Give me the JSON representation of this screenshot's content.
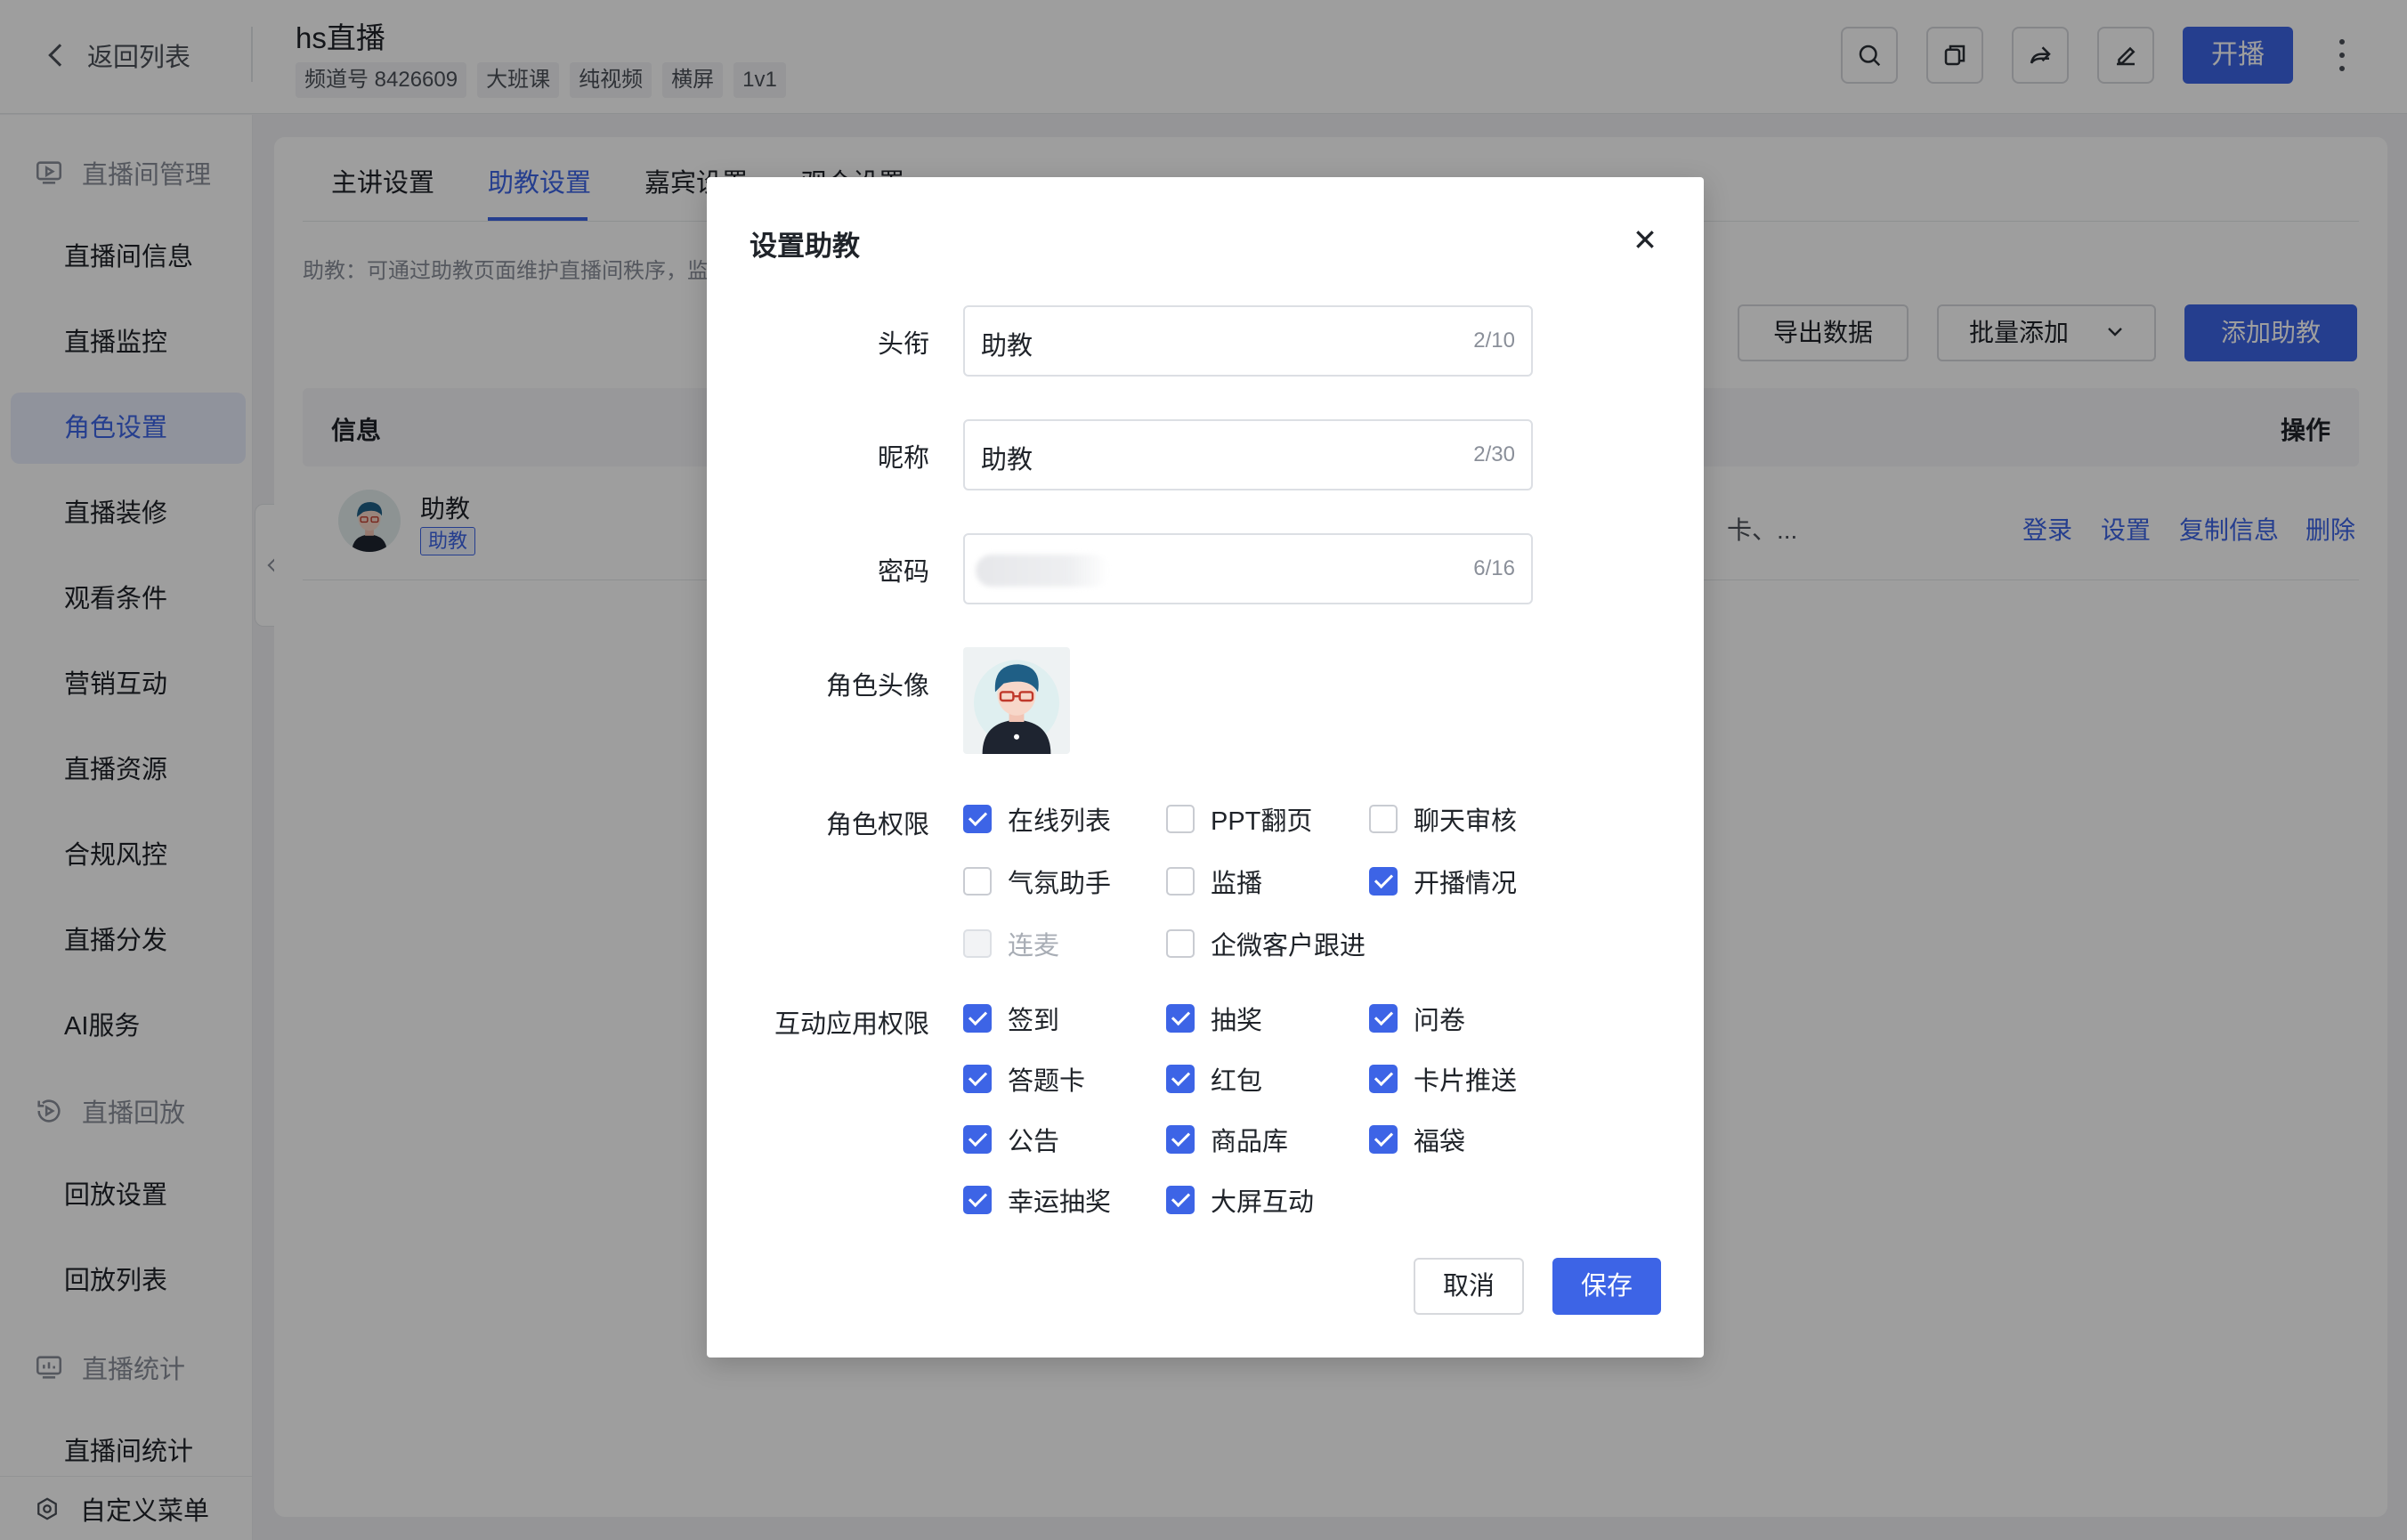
{
  "header": {
    "back_label": "返回列表",
    "room_title": "hs直播",
    "tags": [
      "频道号 8426609",
      "大班课",
      "纯视频",
      "横屏",
      "1v1"
    ],
    "start_button": "开播",
    "icons": [
      "search-icon",
      "copy-icon",
      "share-icon",
      "edit-icon",
      "more-icon"
    ]
  },
  "sidebar": {
    "group_live": "直播间管理",
    "items_live": [
      "直播间信息",
      "直播监控",
      "角色设置",
      "直播装修",
      "观看条件",
      "营销互动",
      "直播资源",
      "合规风控",
      "直播分发",
      "AI服务"
    ],
    "group_replay": "直播回放",
    "items_replay": [
      "回放设置",
      "回放列表"
    ],
    "group_stats": "直播统计",
    "items_stats": [
      "直播间统计"
    ],
    "active_item": "角色设置",
    "bottom": "自定义菜单"
  },
  "main": {
    "tabs": [
      "主讲设置",
      "助教设置",
      "嘉宾设置",
      "观众设置"
    ],
    "active_tab": "助教设置",
    "description": "助教：可通过助教页面维护直播间秩序，监",
    "export_button": "导出数据",
    "batch_button": "批量添加",
    "add_button": "添加助教",
    "table": {
      "col_info": "信息",
      "col_ops": "操作",
      "rows": [
        {
          "name": "助教",
          "role_tag": "助教",
          "truncated_text": "卡、...",
          "ops": [
            "登录",
            "设置",
            "复制信息",
            "删除"
          ]
        }
      ]
    }
  },
  "modal": {
    "title": "设置助教",
    "title_field": {
      "label": "头衔",
      "value": "助教",
      "count": "2/10"
    },
    "nickname_field": {
      "label": "昵称",
      "value": "助教",
      "count": "2/30"
    },
    "password_field": {
      "label": "密码",
      "count": "6/16"
    },
    "avatar_label": "角色头像",
    "role_perm_label": "角色权限",
    "role_perms": [
      {
        "label": "在线列表",
        "checked": true,
        "disabled": false
      },
      {
        "label": "PPT翻页",
        "checked": false,
        "disabled": false
      },
      {
        "label": "聊天审核",
        "checked": false,
        "disabled": false
      },
      {
        "label": "气氛助手",
        "checked": false,
        "disabled": false
      },
      {
        "label": "监播",
        "checked": false,
        "disabled": false
      },
      {
        "label": "开播情况",
        "checked": true,
        "disabled": false
      },
      {
        "label": "连麦",
        "checked": false,
        "disabled": true
      },
      {
        "label": "企微客户跟进",
        "checked": false,
        "disabled": false
      }
    ],
    "app_perm_label": "互动应用权限",
    "app_perms": [
      {
        "label": "签到",
        "checked": true
      },
      {
        "label": "抽奖",
        "checked": true
      },
      {
        "label": "问卷",
        "checked": true
      },
      {
        "label": "答题卡",
        "checked": true
      },
      {
        "label": "红包",
        "checked": true
      },
      {
        "label": "卡片推送",
        "checked": true
      },
      {
        "label": "公告",
        "checked": true
      },
      {
        "label": "商品库",
        "checked": true
      },
      {
        "label": "福袋",
        "checked": true
      },
      {
        "label": "幸运抽奖",
        "checked": true
      },
      {
        "label": "大屏互动",
        "checked": true
      }
    ],
    "cancel_button": "取消",
    "save_button": "保存"
  },
  "colors": {
    "accent": "#3d64e6",
    "mask": "rgba(0,0,0,0.38)"
  }
}
